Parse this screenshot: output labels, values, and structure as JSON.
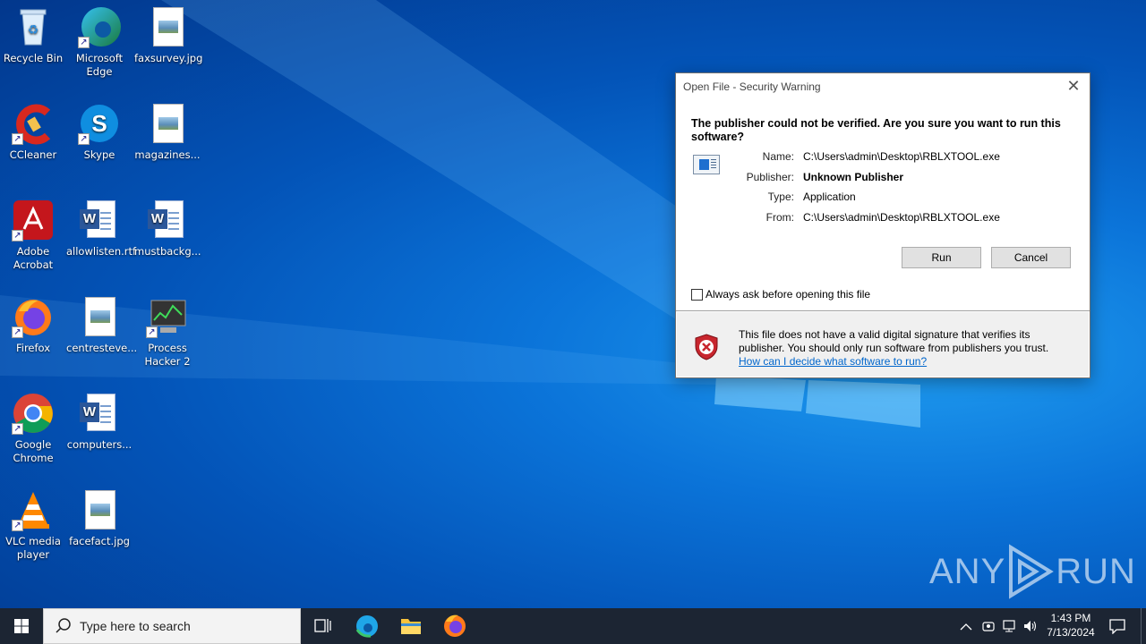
{
  "desktop": {
    "icons": [
      {
        "label": "Recycle Bin"
      },
      {
        "label": "Microsoft Edge"
      },
      {
        "label": "faxsurvey.jpg"
      },
      {
        "label": "CCleaner"
      },
      {
        "label": "Skype"
      },
      {
        "label": "magazines..."
      },
      {
        "label": "Adobe Acrobat"
      },
      {
        "label": "allowlisten.rtf"
      },
      {
        "label": "mustbackg..."
      },
      {
        "label": "Firefox"
      },
      {
        "label": "centresteve..."
      },
      {
        "label": "Process Hacker 2"
      },
      {
        "label": "Google Chrome"
      },
      {
        "label": "computers..."
      },
      {
        "label": "VLC media player"
      },
      {
        "label": "facefact.jpg"
      }
    ]
  },
  "dialog": {
    "title": "Open File - Security Warning",
    "close": "✕",
    "heading": "The publisher could not be verified.  Are you sure you want to run this software?",
    "fields": [
      {
        "key": "Name:",
        "value": "C:\\Users\\admin\\Desktop\\RBLXTOOL.exe"
      },
      {
        "key": "Publisher:",
        "value": "Unknown Publisher"
      },
      {
        "key": "Type:",
        "value": "Application"
      },
      {
        "key": "From:",
        "value": "C:\\Users\\admin\\Desktop\\RBLXTOOL.exe"
      }
    ],
    "run_label": "Run",
    "cancel_label": "Cancel",
    "checkbox_label": "Always ask before opening this file",
    "checkbox_checked": false,
    "warning_text": "This file does not have a valid digital signature that verifies its publisher.  You should only run software from publishers you trust.",
    "help_link": "How can I decide what software to run?"
  },
  "taskbar": {
    "search_placeholder": "Type here to search",
    "time": "1:43 PM",
    "date": "7/13/2024"
  },
  "watermark": {
    "text_left": "ANY",
    "text_right": "RUN"
  }
}
